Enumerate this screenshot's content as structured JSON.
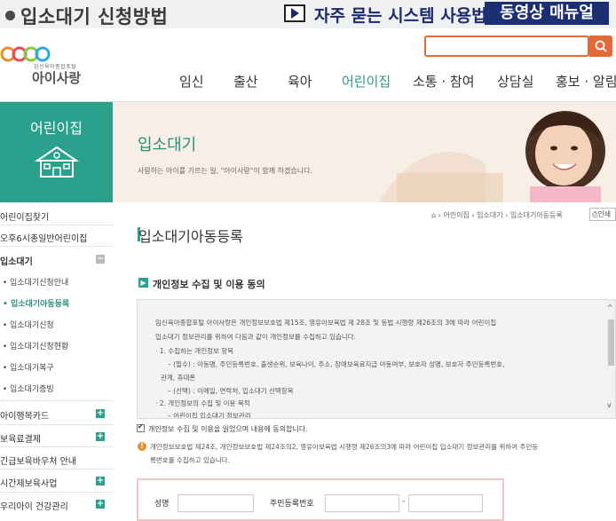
{
  "banner": {
    "title": "입소대기 신청방법",
    "faq": "자주 묻는 시스템 사용법",
    "video": "동영상 매뉴얼"
  },
  "header": {
    "logo_sub": "임신육아종합포털",
    "logo_text": "아이사랑",
    "search_placeholder": "",
    "nav": [
      "임신",
      "출산",
      "육아",
      "어린이집",
      "소통 · 참여",
      "상담실",
      "홍보 · 알림"
    ],
    "active_nav": "어린이집"
  },
  "sidebar": {
    "title": "어린이집",
    "items": [
      {
        "label": "어린이집찾기",
        "type": "main"
      },
      {
        "label": "오후6시총일반어린이집",
        "type": "main"
      },
      {
        "label": "입소대기",
        "type": "main",
        "toggle": "−"
      },
      {
        "label": "입소대기신청안내",
        "type": "sub"
      },
      {
        "label": "입소대기아동등록",
        "type": "sub",
        "active": true
      },
      {
        "label": "입소대기신청",
        "type": "sub"
      },
      {
        "label": "입소대기신청현황",
        "type": "sub"
      },
      {
        "label": "입소대기복구",
        "type": "sub"
      },
      {
        "label": "입소대기증빙",
        "type": "sub"
      },
      {
        "label": "아이행복카드",
        "type": "main",
        "toggle": "+"
      },
      {
        "label": "보육료결제",
        "type": "main",
        "toggle": "+"
      },
      {
        "label": "긴급보육바우처 안내",
        "type": "main"
      },
      {
        "label": "시간제보육사업",
        "type": "main",
        "toggle": "+"
      },
      {
        "label": "우리아이 건강관리",
        "type": "main",
        "toggle": "+"
      }
    ]
  },
  "visual": {
    "title": "입소대기",
    "subtitle": "사랑하는 아이를 기르는 일, \"아이사랑\"이 함께 하겠습니다."
  },
  "breadcrumb": {
    "items": [
      "어린이집",
      "입소대기",
      "입소대기아동등록"
    ],
    "print": "인쇄"
  },
  "page": {
    "title": "입소대기아동등록",
    "section_title": "개인정보 수집 및 이용 동의"
  },
  "consent": {
    "lines": [
      "임신육아종합포털 아이사랑은 개인정보보호법 제15조, 영유아보육법 제 28조 및 동법 시행령 제26조의 3에 따라 어린이집",
      "입소대기 정보관리를 위하여 다음과 같이 개인정보를 수집하고 있습니다.",
      "· 1. 수집하는 개인정보 항목",
      "– (필수) : 아동명, 주민등록번호, 출생순위, 보육나이, 주소, 장애보육료지급 아동여부, 보호자 성명, 보호자 주민등록번호,",
      "관계, 휴대폰",
      "– (선택) : 이메일, 연락처, 입소대기 선택항목",
      "· 2. 개인정보의 수집 및 이용 목적",
      "– 어린이집 입소대기 정보관리"
    ]
  },
  "agree": {
    "checked": true,
    "text": "개인정보 수집 및 이용을 읽었으며 내용에 동의합니다."
  },
  "notice": {
    "lines": [
      "개인정보보호법 제24조, 개인정보보호법 제24조의2, 영유아보육법 시행령 제26조의3에 따라 어린이집 입소대기 정보관리를 위하여 주민등",
      "록번호를 수집하고 있습니다."
    ]
  },
  "form": {
    "name_label": "성명",
    "rrn_label": "주민등록번호",
    "dash": "-"
  }
}
